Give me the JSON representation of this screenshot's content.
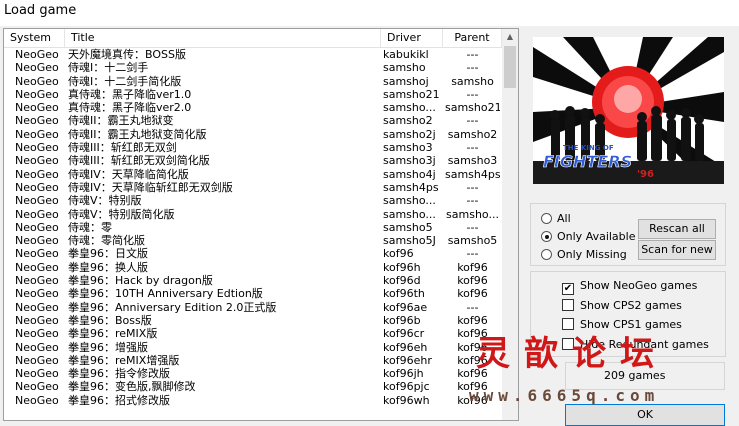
{
  "window": {
    "title": "Load game"
  },
  "columns": {
    "system": "System",
    "title": "Title",
    "driver": "Driver",
    "parent": "Parent"
  },
  "rows": [
    {
      "system": "NeoGeo",
      "title": "天外魔境真传：BOSS版",
      "driver": "kabukikl",
      "parent": "---"
    },
    {
      "system": "NeoGeo",
      "title": "侍魂I：十二剑手",
      "driver": "samsho",
      "parent": "---"
    },
    {
      "system": "NeoGeo",
      "title": "侍魂I：十二剑手简化版",
      "driver": "samshoj",
      "parent": "samsho"
    },
    {
      "system": "NeoGeo",
      "title": "真侍魂：黑子降临ver1.0",
      "driver": "samsho21",
      "parent": "---"
    },
    {
      "system": "NeoGeo",
      "title": "真侍魂：黑子降临ver2.0",
      "driver": "samsho...",
      "parent": "samsho21"
    },
    {
      "system": "NeoGeo",
      "title": "侍魂II：霸王丸地狱变",
      "driver": "samsho2",
      "parent": "---"
    },
    {
      "system": "NeoGeo",
      "title": "侍魂II：霸王丸地狱变简化版",
      "driver": "samsho2j",
      "parent": "samsho2"
    },
    {
      "system": "NeoGeo",
      "title": "侍魂III：斩红郎无双剑",
      "driver": "samsho3",
      "parent": "---"
    },
    {
      "system": "NeoGeo",
      "title": "侍魂III：斩红郎无双剑简化版",
      "driver": "samsho3j",
      "parent": "samsho3"
    },
    {
      "system": "NeoGeo",
      "title": "侍魂IV：天草降临简化版",
      "driver": "samsho4j",
      "parent": "samsh4ps"
    },
    {
      "system": "NeoGeo",
      "title": "侍魂IV：天草降临斩红郎无双剑版",
      "driver": "samsh4ps",
      "parent": "---"
    },
    {
      "system": "NeoGeo",
      "title": "侍魂V：特别版",
      "driver": "samsho...",
      "parent": "---"
    },
    {
      "system": "NeoGeo",
      "title": "侍魂V：特别版简化版",
      "driver": "samsho...",
      "parent": "samsho..."
    },
    {
      "system": "NeoGeo",
      "title": "侍魂：零",
      "driver": "samsho5",
      "parent": "---"
    },
    {
      "system": "NeoGeo",
      "title": "侍魂：零简化版",
      "driver": "samsho5J",
      "parent": "samsho5"
    },
    {
      "system": "NeoGeo",
      "title": "拳皇96：日文版",
      "driver": "kof96",
      "parent": "---"
    },
    {
      "system": "NeoGeo",
      "title": "拳皇96：换人版",
      "driver": "kof96h",
      "parent": "kof96"
    },
    {
      "system": "NeoGeo",
      "title": "拳皇96：Hack by dragon版",
      "driver": "kof96d",
      "parent": "kof96"
    },
    {
      "system": "NeoGeo",
      "title": "拳皇96：10TH Anniversary Edtion版",
      "driver": "kof96th",
      "parent": "kof96"
    },
    {
      "system": "NeoGeo",
      "title": "拳皇96：Anniversary Edition 2.0正式版",
      "driver": "kof96ae",
      "parent": "---"
    },
    {
      "system": "NeoGeo",
      "title": "拳皇96：Boss版",
      "driver": "kof96b",
      "parent": "kof96"
    },
    {
      "system": "NeoGeo",
      "title": "拳皇96：reMIX版",
      "driver": "kof96cr",
      "parent": "kof96"
    },
    {
      "system": "NeoGeo",
      "title": "拳皇96：增强版",
      "driver": "kof96eh",
      "parent": "kof96"
    },
    {
      "system": "NeoGeo",
      "title": "拳皇96：reMIX增强版",
      "driver": "kof96ehr",
      "parent": "kof96"
    },
    {
      "system": "NeoGeo",
      "title": "拳皇96：指令修改版",
      "driver": "kof96jh",
      "parent": "kof96"
    },
    {
      "system": "NeoGeo",
      "title": "拳皇96：变色版,飘脚修改",
      "driver": "kof96pjc",
      "parent": "kof96"
    },
    {
      "system": "NeoGeo",
      "title": "拳皇96：招式修改版",
      "driver": "kof96wh",
      "parent": "kof96"
    }
  ],
  "filters": {
    "all": "All",
    "only_available": "Only Available",
    "only_missing": "Only Missing",
    "selected": "only_available"
  },
  "buttons": {
    "rescan": "Rescan all",
    "scan_new": "Scan for new",
    "ok": "OK"
  },
  "options": [
    {
      "label": "Show NeoGeo games",
      "checked": true
    },
    {
      "label": "Show CPS2 games",
      "checked": false
    },
    {
      "label": "Show CPS1 games",
      "checked": false
    },
    {
      "label": "Hide Redundant games",
      "checked": false
    }
  ],
  "status": {
    "games_count": "209 games"
  },
  "preview": {
    "logo_line1": "THE KING OF",
    "logo_line2": "FIGHTERS",
    "logo_year": "'96"
  },
  "watermark": {
    "chinese": "灵歆论坛",
    "url": "www.6665q.com"
  },
  "colors": {
    "focus_border": "#0078d7",
    "watermark_red": "#d01818"
  }
}
